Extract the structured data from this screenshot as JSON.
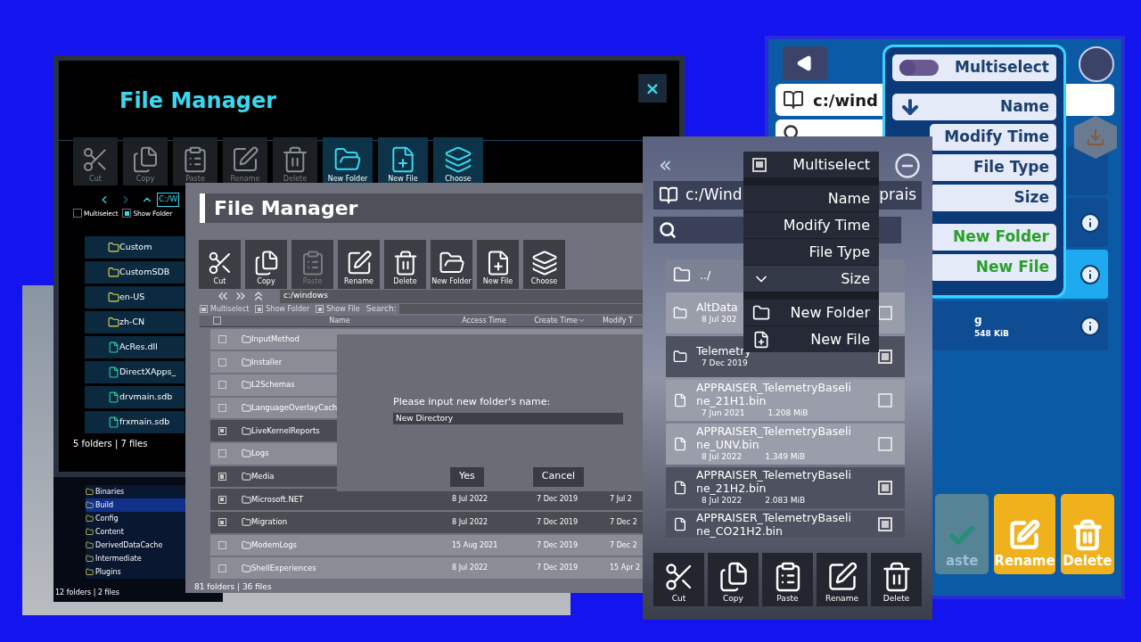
{
  "scene_window": {
    "rows": [
      {
        "name": "Binaries",
        "selected": false
      },
      {
        "name": "Build",
        "selected": true
      },
      {
        "name": "Config",
        "selected": false
      },
      {
        "name": "Content",
        "selected": false
      },
      {
        "name": "DerivedDataCache",
        "selected": false
      },
      {
        "name": "Intermediate",
        "selected": false
      },
      {
        "name": "Plugins",
        "selected": false
      }
    ],
    "status": "12 folders | 2 files"
  },
  "dark_window": {
    "title": "File Manager",
    "close": "×",
    "toolbar": [
      {
        "label": "Cut",
        "highlighted": false
      },
      {
        "label": "Copy",
        "highlighted": false
      },
      {
        "label": "Paste",
        "highlighted": false
      },
      {
        "label": "Rename",
        "highlighted": false
      },
      {
        "label": "Delete",
        "highlighted": false
      },
      {
        "label": "New Folder",
        "highlighted": true
      },
      {
        "label": "New File",
        "highlighted": true
      },
      {
        "label": "Choose",
        "highlighted": true
      }
    ],
    "path": "C:/W",
    "options": [
      {
        "label": "Multiselect",
        "checked": false
      },
      {
        "label": "Show Folder",
        "checked": true
      }
    ],
    "rows": [
      {
        "kind": "folder",
        "name": "Custom"
      },
      {
        "kind": "folder",
        "name": "CustomSDB"
      },
      {
        "kind": "folder",
        "name": "en-US"
      },
      {
        "kind": "folder",
        "name": "zh-CN"
      },
      {
        "kind": "file",
        "name": "AcRes.dll"
      },
      {
        "kind": "file",
        "name": "DirectXApps_"
      },
      {
        "kind": "file",
        "name": "drvmain.sdb"
      },
      {
        "kind": "file",
        "name": "frxmain.sdb"
      }
    ],
    "status": "5 folders | 7 files"
  },
  "grey_window": {
    "title": "File Manager",
    "toolbar": [
      {
        "label": "Cut",
        "disabled": false
      },
      {
        "label": "Copy",
        "disabled": false
      },
      {
        "label": "Paste",
        "disabled": true
      },
      {
        "label": "Rename",
        "disabled": false
      },
      {
        "label": "Delete",
        "disabled": false
      },
      {
        "label": "New Folder",
        "disabled": false
      },
      {
        "label": "New File",
        "disabled": false
      },
      {
        "label": "Choose",
        "disabled": false
      }
    ],
    "path": "c:/windows",
    "options": [
      {
        "label": "Multiselect",
        "checked": true
      },
      {
        "label": "Show Folder",
        "checked": true
      },
      {
        "label": "Show File",
        "checked": true
      }
    ],
    "search_label": "Search:",
    "header_checked": false,
    "columns": [
      "Name",
      "Access Time",
      "Create Time",
      "Modify T"
    ],
    "rows": [
      {
        "name": "InputMethod",
        "checked": false
      },
      {
        "name": "Installer",
        "checked": false
      },
      {
        "name": "L2Schemas",
        "checked": false
      },
      {
        "name": "LanguageOverlayCach",
        "checked": false
      },
      {
        "name": "LiveKernelReports",
        "checked": true
      },
      {
        "name": "Logs",
        "checked": false
      },
      {
        "name": "Media",
        "checked": true
      },
      {
        "name": "Microsoft.NET",
        "checked": true,
        "access": "8 Jul 2022",
        "create": "7 Dec 2019",
        "modify": "7 Jul 2"
      },
      {
        "name": "Migration",
        "checked": true,
        "access": "8 Jul 2022",
        "create": "7 Dec 2019",
        "modify": "7 Dec 2"
      },
      {
        "name": "ModemLogs",
        "checked": false,
        "access": "15 Aug 2021",
        "create": "7 Dec 2019",
        "modify": "7 Dec 2"
      },
      {
        "name": "ShellExperiences",
        "checked": false,
        "access": "8 Jul 2022",
        "create": "7 Dec 2019",
        "modify": "15 Apr 2"
      }
    ],
    "dialog": {
      "prompt": "Please input new folder's name:",
      "value": "New Directory",
      "buttons": [
        "Yes",
        "Cancel"
      ]
    },
    "status": "81 folders | 36 files"
  },
  "mobile_window": {
    "back": "«",
    "path_start": "c:/Wind",
    "path_end": "prais",
    "rows": [
      {
        "kind": "parent",
        "name": "../"
      },
      {
        "kind": "folder",
        "name": "AltData",
        "date": "8 Jul 202",
        "checked": false
      },
      {
        "kind": "folder",
        "name": "Telemetry",
        "date": "7 Dec 2019",
        "checked": true
      },
      {
        "kind": "file",
        "name": "APPRAISER_TelemetryBaseline_21H1.bin",
        "date": "7 Jun 2021",
        "size": "1.208 MiB",
        "checked": false
      },
      {
        "kind": "file",
        "name": "APPRAISER_TelemetryBaseline_UNV.bin",
        "date": "8 Jul 2022",
        "size": "1.349 MiB",
        "checked": false
      },
      {
        "kind": "file",
        "name": "APPRAISER_TelemetryBaseline_21H2.bin",
        "date": "8 Jul 2022",
        "size": "2.083 MiB",
        "checked": true
      },
      {
        "kind": "file",
        "name": "APPRAISER_TelemetryBaseline_CO21H2.bin",
        "checked": true
      }
    ],
    "menu": [
      {
        "kind": "check",
        "label": "Multiselect",
        "checked": true
      },
      {
        "kind": "sort",
        "label": "Name",
        "selected": false
      },
      {
        "kind": "sort",
        "label": "Modify Time",
        "selected": false
      },
      {
        "kind": "sort",
        "label": "File Type",
        "selected": false
      },
      {
        "kind": "sort",
        "label": "Size",
        "selected": true
      },
      {
        "kind": "action",
        "label": "New Folder"
      },
      {
        "kind": "action",
        "label": "New File"
      }
    ],
    "toolbar": [
      "Cut",
      "Copy",
      "Paste",
      "Rename",
      "Delete"
    ]
  },
  "blue_window": {
    "path": "c:/wind",
    "rows": [
      {
        "selected": false,
        "info": false
      },
      {
        "selected": false,
        "info": true
      },
      {
        "selected": true,
        "info": true
      },
      {
        "name": "g",
        "detail": "548 KiB",
        "selected": false,
        "info": true
      }
    ],
    "menu": [
      {
        "kind": "toggle",
        "label": "Multiselect",
        "on": false
      },
      {
        "kind": "sort",
        "label": "Name",
        "selected": true
      },
      {
        "kind": "sort",
        "label": "Modify Time",
        "selected": false
      },
      {
        "kind": "sort",
        "label": "File Type",
        "selected": false
      },
      {
        "kind": "sort",
        "label": "Size",
        "selected": false
      },
      {
        "kind": "action",
        "label": "New Folder"
      },
      {
        "kind": "action",
        "label": "New File"
      }
    ],
    "toolbar": [
      {
        "label": "aste",
        "disabled": true
      },
      {
        "label": "Rename",
        "disabled": false
      },
      {
        "label": "Delete",
        "disabled": false
      }
    ]
  }
}
